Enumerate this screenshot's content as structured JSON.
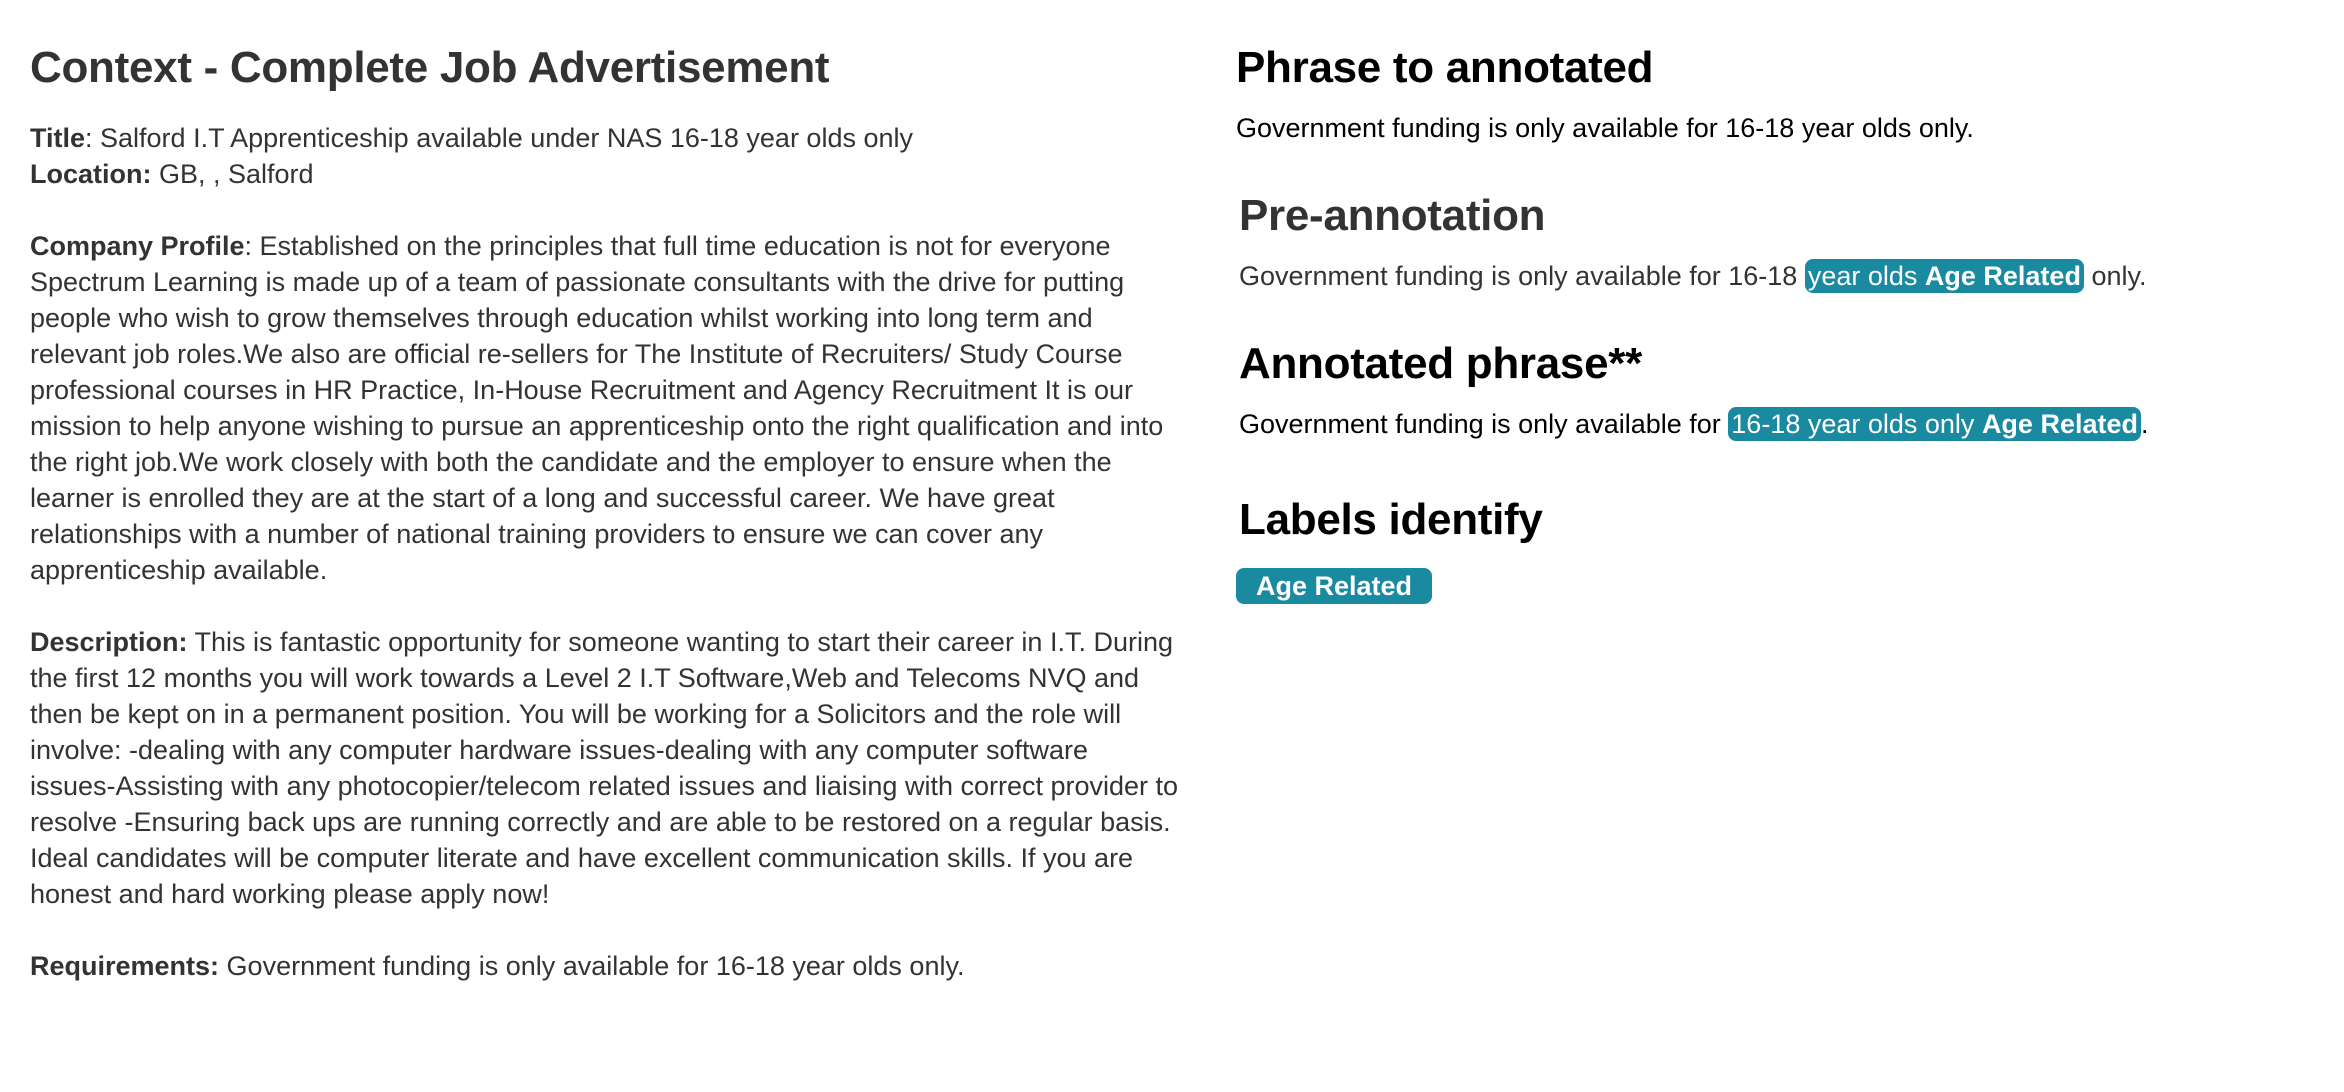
{
  "context": {
    "heading": "Context - Complete Job Advertisement",
    "title_label": "Title",
    "title_value": ": Salford I.T Apprenticeship available under NAS 16-18 year olds only",
    "location_label": "Location:",
    "location_value": " GB, , Salford",
    "company_label": "Company Profile",
    "company_value": ": Established on the principles that full time education is not for everyone Spectrum Learning is made up of a team of passionate consultants with the drive for putting people who wish to grow themselves through education whilst working into long term and relevant job roles.We also are official re-sellers for The Institute of Recruiters/ Study Course professional courses in HR Practice, In-House Recruitment and Agency Recruitment It is our mission to help anyone wishing to pursue an apprenticeship onto the right qualification and into the right job.We work closely with both the candidate and the employer to ensure when the learner is enrolled they are at the start of a long and successful career. We have great relationships with a number of national training providers to ensure we can cover any apprenticeship available.",
    "description_label": "Description:",
    "description_value": " This is fantastic opportunity for someone wanting to start their career in I.T. During the first 12 months you will work towards a Level 2 I.T Software,Web and Telecoms NVQ and then be kept on in a permanent position. You will be working for a Solicitors and the role will involve: -dealing with any computer hardware issues-dealing with any computer software issues-Assisting with any photocopier/telecom related issues and liaising with correct provider to resolve -Ensuring back ups are running correctly and are able to be restored on a regular basis. Ideal candidates will be computer literate and have excellent communication skills. If you are honest and hard working please apply now!",
    "requirements_label": "Requirements:",
    "requirements_value": " Government funding is only available for 16-18 year olds only."
  },
  "phrase": {
    "heading": "Phrase to annotated",
    "text": "Government funding is only available for 16-18 year olds only."
  },
  "pre_annotation": {
    "heading": "Pre-annotation",
    "before": "Government funding is only available for 16-18 ",
    "span_text": "year olds ",
    "span_label": "Age Related",
    "after": " only."
  },
  "annotated": {
    "heading": "Annotated phrase**",
    "before": "Government funding is only available for ",
    "span_text": "16-18 year olds only ",
    "span_label": "Age Related",
    "after": "."
  },
  "labels": {
    "heading": "Labels identify",
    "items": [
      "Age Related"
    ]
  },
  "colors": {
    "tag_background": "#1a8aa0",
    "text": "#333333"
  }
}
